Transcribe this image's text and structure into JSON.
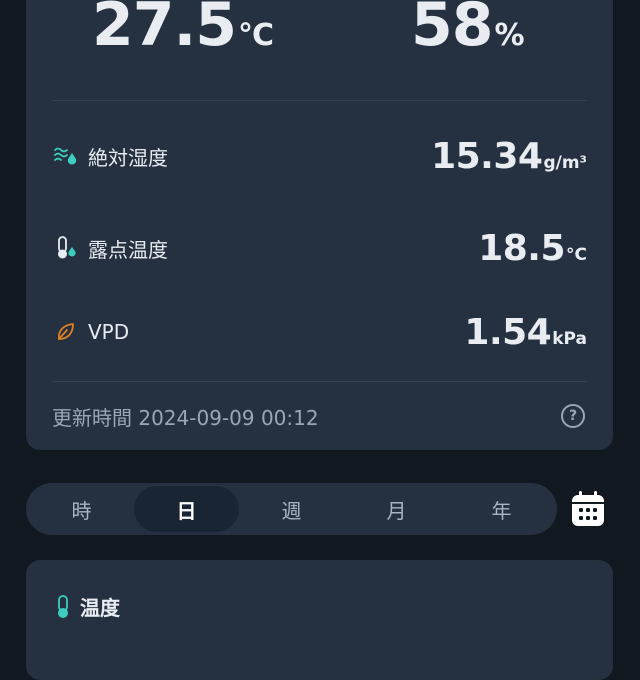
{
  "summary": {
    "temperature": {
      "value": "27.5",
      "unit": "°C"
    },
    "humidity": {
      "value": "58",
      "unit": "%"
    }
  },
  "metrics": [
    {
      "label": "絶対湿度",
      "value": "15.34",
      "unit": "g/m³",
      "icon": "absolute-humidity-icon",
      "color": "#3ccfc0"
    },
    {
      "label": "露点温度",
      "value": "18.5",
      "unit": "°C",
      "icon": "dew-point-icon",
      "color": "#3ccfc0"
    },
    {
      "label": "VPD",
      "value": "1.54",
      "unit": "kPa",
      "icon": "leaf-icon",
      "color": "#e2801f"
    }
  ],
  "updated": {
    "label": "更新時間",
    "timestamp": "2024-09-09 00:12"
  },
  "period_tabs": {
    "items": [
      "時",
      "日",
      "週",
      "月",
      "年"
    ],
    "selected": "日"
  },
  "chart_card": {
    "title": "温度",
    "icon": "thermometer-icon"
  },
  "colors": {
    "background": "#111820",
    "card": "#253140",
    "accent_teal": "#3ccfc0",
    "accent_orange": "#e2801f"
  }
}
